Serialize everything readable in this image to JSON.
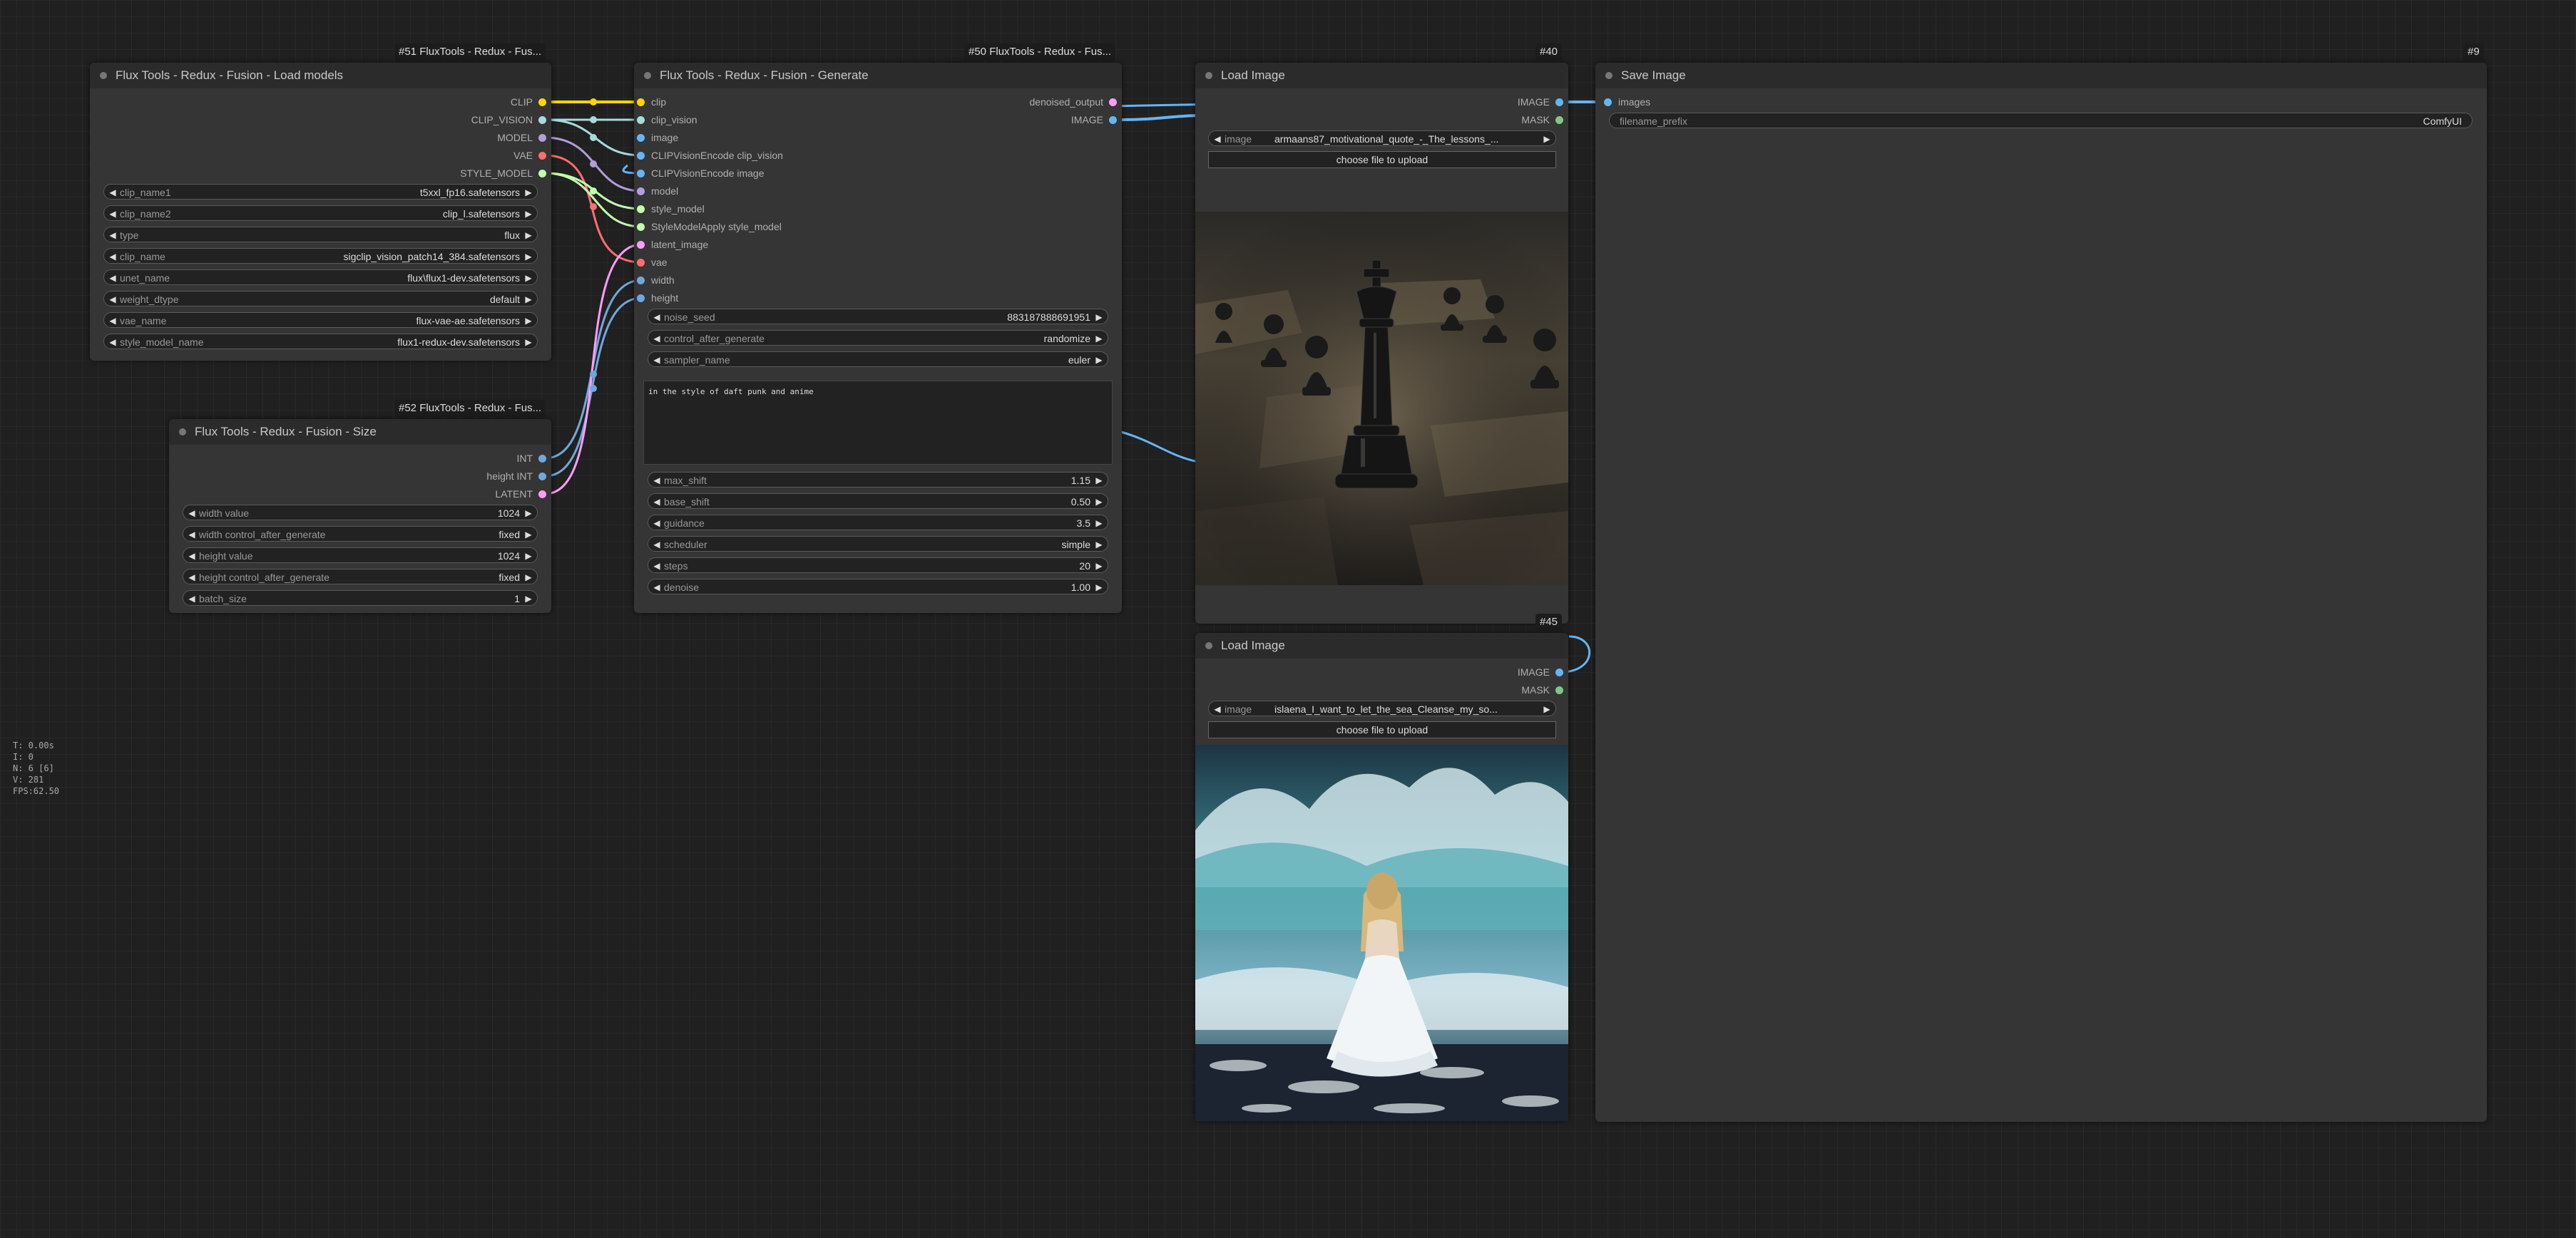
{
  "badges": {
    "n51": "#51 FluxTools - Redux - Fus...",
    "n50": "#50 FluxTools - Redux - Fus...",
    "n52": "#52 FluxTools - Redux - Fus...",
    "n40": "#40",
    "n45": "#45",
    "n9": "#9"
  },
  "load_models": {
    "title": "Flux Tools - Redux - Fusion - Load models",
    "outputs": [
      "CLIP",
      "CLIP_VISION",
      "MODEL",
      "VAE",
      "STYLE_MODEL"
    ],
    "widgets": [
      {
        "name": "clip_name1",
        "value": "t5xxl_fp16.safetensors"
      },
      {
        "name": "clip_name2",
        "value": "clip_l.safetensors"
      },
      {
        "name": "type",
        "value": "flux"
      },
      {
        "name": "clip_name",
        "value": "sigclip_vision_patch14_384.safetensors"
      },
      {
        "name": "unet_name",
        "value": "flux\\flux1-dev.safetensors"
      },
      {
        "name": "weight_dtype",
        "value": "default"
      },
      {
        "name": "vae_name",
        "value": "flux-vae-ae.safetensors"
      },
      {
        "name": "style_model_name",
        "value": "flux1-redux-dev.safetensors"
      }
    ]
  },
  "size": {
    "title": "Flux Tools - Redux - Fusion - Size",
    "outputs": [
      "INT",
      "height INT",
      "LATENT"
    ],
    "widgets": [
      {
        "name": "width value",
        "value": "1024"
      },
      {
        "name": "width control_after_generate",
        "value": "fixed"
      },
      {
        "name": "height value",
        "value": "1024"
      },
      {
        "name": "height control_after_generate",
        "value": "fixed"
      },
      {
        "name": "batch_size",
        "value": "1"
      }
    ]
  },
  "generate": {
    "title": "Flux Tools - Redux - Fusion - Generate",
    "inputs": [
      "clip",
      "clip_vision",
      "image",
      "CLIPVisionEncode clip_vision",
      "CLIPVisionEncode image",
      "model",
      "style_model",
      "StyleModelApply style_model",
      "latent_image",
      "vae",
      "width",
      "height"
    ],
    "outputs": [
      "denoised_output",
      "IMAGE"
    ],
    "widgets_top": [
      {
        "name": "noise_seed",
        "value": "883187888691951"
      },
      {
        "name": "control_after_generate",
        "value": "randomize"
      },
      {
        "name": "sampler_name",
        "value": "euler"
      }
    ],
    "prompt": "in the style of daft punk and anime",
    "widgets_bottom": [
      {
        "name": "max_shift",
        "value": "1.15"
      },
      {
        "name": "base_shift",
        "value": "0.50"
      },
      {
        "name": "guidance",
        "value": "3.5"
      },
      {
        "name": "scheduler",
        "value": "simple"
      },
      {
        "name": "steps",
        "value": "20"
      },
      {
        "name": "denoise",
        "value": "1.00"
      }
    ]
  },
  "load_image_1": {
    "title": "Load Image",
    "outputs": [
      "IMAGE",
      "MASK"
    ],
    "image_label": "image",
    "image_value": "armaans87_motivational_quote_-_The_lessons_...",
    "upload_label": "choose file to upload"
  },
  "load_image_2": {
    "title": "Load Image",
    "outputs": [
      "IMAGE",
      "MASK"
    ],
    "image_label": "image",
    "image_value": "islaena_I_want_to_let_the_sea_Cleanse_my_so...",
    "upload_label": "choose file to upload"
  },
  "save_image": {
    "title": "Save Image",
    "inputs": [
      "images"
    ],
    "filename_label": "filename_prefix",
    "filename_value": "ComfyUI"
  },
  "stats": [
    "T: 0.00s",
    "I: 0",
    "N: 6 [6]",
    "V: 281",
    "FPS:62.50"
  ],
  "colors": {
    "clip": "#ffd500",
    "clip_vision": "#a8dadc",
    "image": "#64b5f6",
    "model": "#b39ddb",
    "vae": "#ff6e6e",
    "style_model": "#c2ffae",
    "latent": "#ff9cf9",
    "int": "#6fa8dc",
    "mask": "#81c784"
  }
}
